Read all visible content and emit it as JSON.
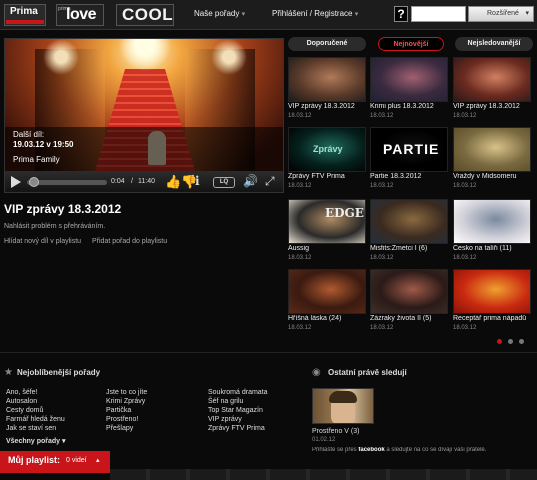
{
  "header": {
    "logos": [
      "Prima",
      "love",
      "COOL"
    ],
    "love_small": "prima",
    "nav": [
      {
        "label": "Naše pořady",
        "caret": "▾"
      },
      {
        "label": "Přihlášení / Registrace",
        "caret": "▾"
      }
    ],
    "help": "?",
    "search": {
      "value": "",
      "placeholder": ""
    },
    "advanced_search": "Rozšířené",
    "advanced_caret": "▾"
  },
  "player": {
    "next_label": "Další díl:",
    "next_date": "19.03.12 v 19:50",
    "channel": "Prima Family",
    "time_current": "0:04",
    "time_sep": "/",
    "time_total": "11:40",
    "quality": "LQ",
    "progress_fraction": 0.01
  },
  "video": {
    "title": "VIP zprávy 18.3.2012",
    "report": "Nahlásit problém s přehráváním.",
    "link_a": "Hlídat nový díl v playlistu",
    "link_b": "Přidat pořad do playlistu"
  },
  "tabs": [
    "Doporučené",
    "Nejnovější",
    "Nejsledovanější"
  ],
  "active_tab": "Nejnovější",
  "grid": [
    {
      "title": "VIP zprávy 18.3.2012",
      "date": "18.03.12",
      "colors": [
        "#5a3a2a",
        "#b07a58",
        "#1a1a1a"
      ]
    },
    {
      "title": "Krimi plus 18.3.2012",
      "date": "18.03.12",
      "colors": [
        "#3a2a40",
        "#a06070",
        "#202030"
      ]
    },
    {
      "title": "VIP zprávy 18.3.2012",
      "date": "18.03.12",
      "colors": [
        "#6a2a20",
        "#d08060",
        "#2a1818"
      ]
    },
    {
      "title": "Zprávy FTV Prima",
      "date": "18.03.12",
      "colors": [
        "#05201c",
        "#1f6a5a",
        "#000000"
      ]
    },
    {
      "title": "Partie 18.3.2012",
      "date": "18.03.12",
      "colors": [
        "#000000",
        "#111111",
        "#000000"
      ]
    },
    {
      "title": "Vraždy v Midsomeru",
      "date": "18.03.12",
      "colors": [
        "#7a6a40",
        "#d9c28a",
        "#5a4a28"
      ]
    },
    {
      "title": "Aussig",
      "date": "18.03.12",
      "colors": [
        "#2a2a2a",
        "#b08a60",
        "#e8e0d0"
      ]
    },
    {
      "title": "Misfits:Zmetci I (6)",
      "date": "18.03.12",
      "colors": [
        "#3a2a20",
        "#8a6a40",
        "#203040"
      ]
    },
    {
      "title": "Česko na talíři (11)",
      "date": "18.03.12",
      "colors": [
        "#d0d0d8",
        "#7a8aa0",
        "#ffffff"
      ]
    },
    {
      "title": "Hříšná láska (24)",
      "date": "18.03.12",
      "colors": [
        "#3a1a10",
        "#b05a30",
        "#5a2a18"
      ]
    },
    {
      "title": "Zázraky života II (5)",
      "date": "18.03.12",
      "colors": [
        "#2a1a18",
        "#a05a48",
        "#40302a"
      ]
    },
    {
      "title": "Receptář prima nápadů",
      "date": "18.03.12",
      "colors": [
        "#c92a10",
        "#f0a030",
        "#8a1208"
      ]
    }
  ],
  "partie_text": "PARTIE",
  "zpravy_text": "Zprávy",
  "edge_text": "EDGE",
  "pager": {
    "count": 3,
    "active": 0
  },
  "popular": {
    "title": "Nejoblíbenější pořady",
    "columns": [
      [
        "Ano, šéfe!",
        "Autosalon",
        "Cesty domů",
        "Farmář hledá ženu",
        "Jak se staví sen"
      ],
      [
        "Jste to co jíte",
        "Krimi Zprávy",
        "Partička",
        "Prostřeno!",
        "Přešlapy"
      ],
      [
        "Soukromá dramata",
        "Šéf na grilu",
        "Top Star Magazín",
        "VIP zprávy",
        "Zprávy FTV Prima"
      ]
    ],
    "all": "Všechny pořady",
    "all_caret": "▾"
  },
  "watching": {
    "title": "Ostatní právě sledují",
    "name": "Prostřeno V (3)",
    "date": "01.02.12",
    "fb_pre": "Přihlašte se přes ",
    "fb_word": "facebook",
    "fb_post": " a sledujte na co se dívají vaši přátelé."
  },
  "playlist": {
    "label": "Můj playlist:",
    "count": "0 videí",
    "caret": "▴"
  },
  "colors": {
    "accent": "#c9141a",
    "background": "#0a0a0a"
  },
  "icons": {
    "play": "play-icon",
    "thumbs": "thumbs-icon",
    "info": "info-icon",
    "volume": "volume-icon",
    "fullscreen": "fullscreen-icon",
    "star": "star-icon",
    "eye": "eye-icon"
  }
}
